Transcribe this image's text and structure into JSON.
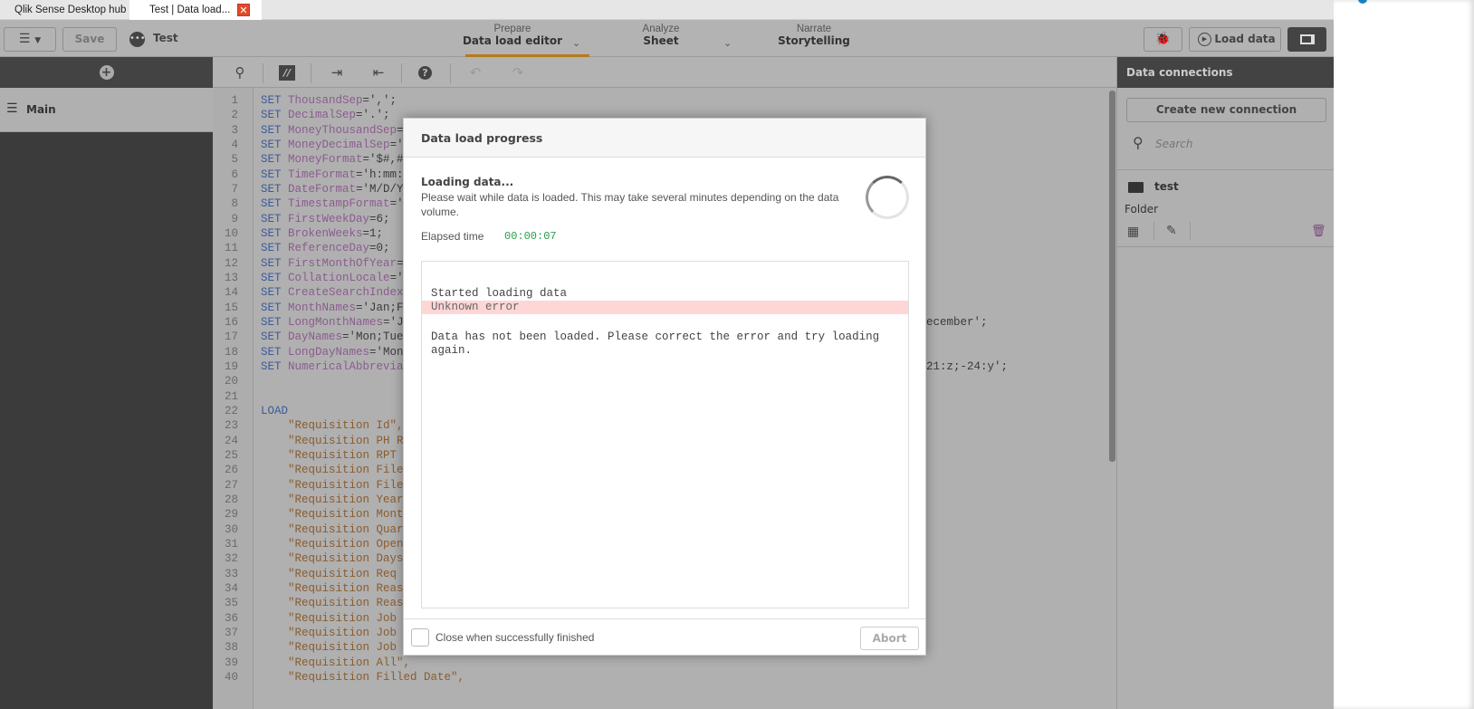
{
  "browser_tabs": [
    {
      "label": "Qlik Sense Desktop hub"
    },
    {
      "label": "Test | Data load..."
    }
  ],
  "toolbar": {
    "save_label": "Save",
    "app_name": "Test",
    "load_data_label": "Load data",
    "nav": [
      {
        "section": "Prepare",
        "label": "Data load editor"
      },
      {
        "section": "Analyze",
        "label": "Sheet"
      },
      {
        "section": "Narrate",
        "label": "Storytelling"
      }
    ]
  },
  "sidebar": {
    "section": "Main"
  },
  "code_lines": [
    {
      "n": "1",
      "kw": "SET",
      "name": "ThousandSep",
      "rest": "=',';"
    },
    {
      "n": "2",
      "kw": "SET",
      "name": "DecimalSep",
      "rest": "='.';"
    },
    {
      "n": "3",
      "kw": "SET",
      "name": "MoneyThousandSep",
      "rest": "="
    },
    {
      "n": "4",
      "kw": "SET",
      "name": "MoneyDecimalSep",
      "rest": "='"
    },
    {
      "n": "5",
      "kw": "SET",
      "name": "MoneyFormat",
      "rest": "='$#,#"
    },
    {
      "n": "6",
      "kw": "SET",
      "name": "TimeFormat",
      "rest": "='h:mm:"
    },
    {
      "n": "7",
      "kw": "SET",
      "name": "DateFormat",
      "rest": "='M/D/Y"
    },
    {
      "n": "8",
      "kw": "SET",
      "name": "TimestampFormat",
      "rest": "='"
    },
    {
      "n": "9",
      "kw": "SET",
      "name": "FirstWeekDay",
      "rest": "=6;"
    },
    {
      "n": "10",
      "kw": "SET",
      "name": "BrokenWeeks",
      "rest": "=1;"
    },
    {
      "n": "11",
      "kw": "SET",
      "name": "ReferenceDay",
      "rest": "=0;"
    },
    {
      "n": "12",
      "kw": "SET",
      "name": "FirstMonthOfYear",
      "rest": "="
    },
    {
      "n": "13",
      "kw": "SET",
      "name": "CollationLocale",
      "rest": "='"
    },
    {
      "n": "14",
      "kw": "SET",
      "name": "CreateSearchIndex",
      "rest": ""
    },
    {
      "n": "15",
      "kw": "SET",
      "name": "MonthNames",
      "rest": "='Jan;F"
    },
    {
      "n": "16",
      "kw": "SET",
      "name": "LongMonthNames",
      "rest": "='J",
      "tail": "ecember';"
    },
    {
      "n": "17",
      "kw": "SET",
      "name": "DayNames",
      "rest": "='Mon;Tue"
    },
    {
      "n": "18",
      "kw": "SET",
      "name": "LongDayNames",
      "rest": "='Mon"
    },
    {
      "n": "19",
      "kw": "SET",
      "name": "NumericalAbbrevia",
      "rest": "",
      "tail": "21:z;-24:y';"
    },
    {
      "n": "20"
    },
    {
      "n": "21"
    },
    {
      "n": "22",
      "kw": "LOAD"
    },
    {
      "n": "23",
      "str": "    \"Requisition Id\","
    },
    {
      "n": "24",
      "str": "    \"Requisition PH R"
    },
    {
      "n": "25",
      "str": "    \"Requisition RPT "
    },
    {
      "n": "26",
      "str": "    \"Requisition File"
    },
    {
      "n": "27",
      "str": "    \"Requisition File"
    },
    {
      "n": "28",
      "str": "    \"Requisition Year"
    },
    {
      "n": "29",
      "str": "    \"Requisition Mont"
    },
    {
      "n": "30",
      "str": "    \"Requisition Quar"
    },
    {
      "n": "31",
      "str": "    \"Requisition Open"
    },
    {
      "n": "32",
      "str": "    \"Requisition Days"
    },
    {
      "n": "33",
      "str": "    \"Requisition Req "
    },
    {
      "n": "34",
      "str": "    \"Requisition Reas"
    },
    {
      "n": "35",
      "str": "    \"Requisition Reas"
    },
    {
      "n": "36",
      "str": "    \"Requisition Job "
    },
    {
      "n": "37",
      "str": "    \"Requisition Job "
    },
    {
      "n": "38",
      "str": "    \"Requisition Job "
    },
    {
      "n": "39",
      "str": "    \"Requisition All\","
    },
    {
      "n": "40",
      "str": "    \"Requisition Filled Date\","
    }
  ],
  "data_connections": {
    "title": "Data connections",
    "create_label": "Create new connection",
    "search_placeholder": "Search",
    "items": [
      {
        "name": "test",
        "type": "Folder"
      }
    ]
  },
  "modal": {
    "title": "Data load progress",
    "status_title": "Loading data...",
    "status_desc": "Please wait while data is loaded. This may take several minutes depending on the data volume.",
    "elapsed_label": "Elapsed time",
    "elapsed_value": "00:00:07",
    "log": {
      "started": "Started loading data",
      "error": "Unknown error",
      "message": "Data has not been loaded. Please correct the error and try loading again."
    },
    "close_checkbox_label": "Close when successfully finished",
    "close_checked": false,
    "abort_label": "Abort"
  },
  "colors": {
    "accent": "#b8791b",
    "elapsed": "#2a9d4a",
    "error_bg": "#ffd6d6"
  }
}
